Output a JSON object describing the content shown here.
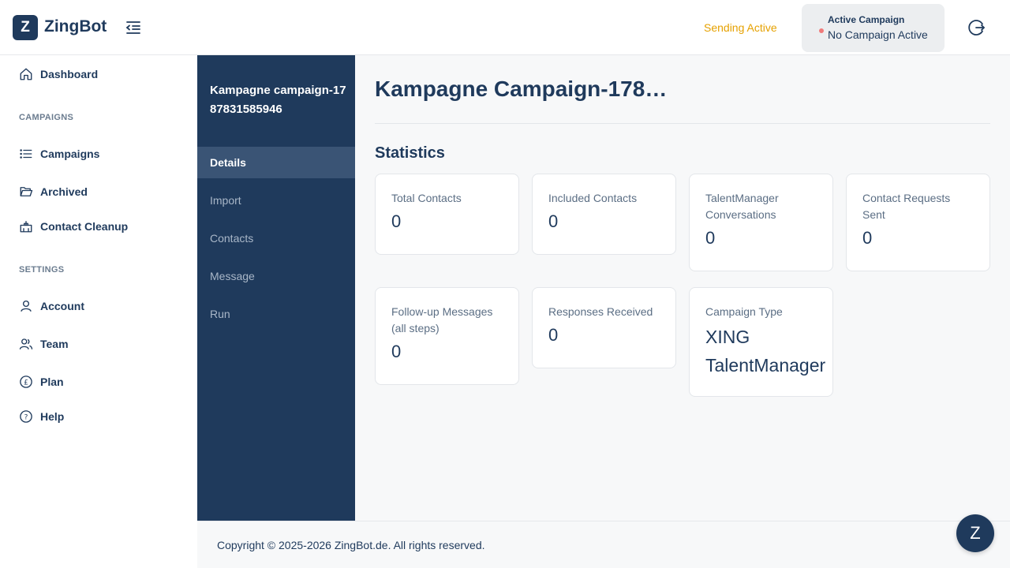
{
  "brand": {
    "logo_letter": "Z",
    "name": "ZingBot"
  },
  "header": {
    "sending_status": "Sending Active",
    "active_campaign_label": "Active Campaign",
    "active_campaign_value": "No Campaign Active"
  },
  "sidebar": {
    "dashboard": "Dashboard",
    "campaigns_section": "CAMPAIGNS",
    "campaigns": "Campaigns",
    "archived": "Archived",
    "contact_cleanup": "Contact Cleanup",
    "settings_section": "SETTINGS",
    "account": "Account",
    "team": "Team",
    "plan": "Plan",
    "help": "Help"
  },
  "subnav": {
    "title": "Kampagne campaign-1787831585946",
    "items": [
      "Details",
      "Import",
      "Contacts",
      "Message",
      "Run"
    ],
    "active": "Details"
  },
  "main": {
    "title": "Kampagne Campaign-178…",
    "statistics_title": "Statistics",
    "stats": [
      {
        "label": "Total Contacts",
        "value": "0"
      },
      {
        "label": "Included Contacts",
        "value": "0"
      },
      {
        "label": "TalentManager Conversations",
        "value": "0"
      },
      {
        "label": "Contact Requests Sent",
        "value": "0"
      },
      {
        "label": "Follow-up Messages (all steps)",
        "value": "0"
      },
      {
        "label": "Responses Received",
        "value": "0"
      },
      {
        "label": "Campaign Type",
        "value": "XING TalentManager"
      }
    ]
  },
  "footer": {
    "copyright": "Copyright © 2025-2026 ZingBot.de. All rights reserved."
  },
  "fab": {
    "letter": "Z"
  },
  "colors": {
    "primary": "#1f3a5c",
    "sending_status": "#e6a100",
    "status_dot": "#f07a7a",
    "subnav_active": "#3a5475"
  }
}
